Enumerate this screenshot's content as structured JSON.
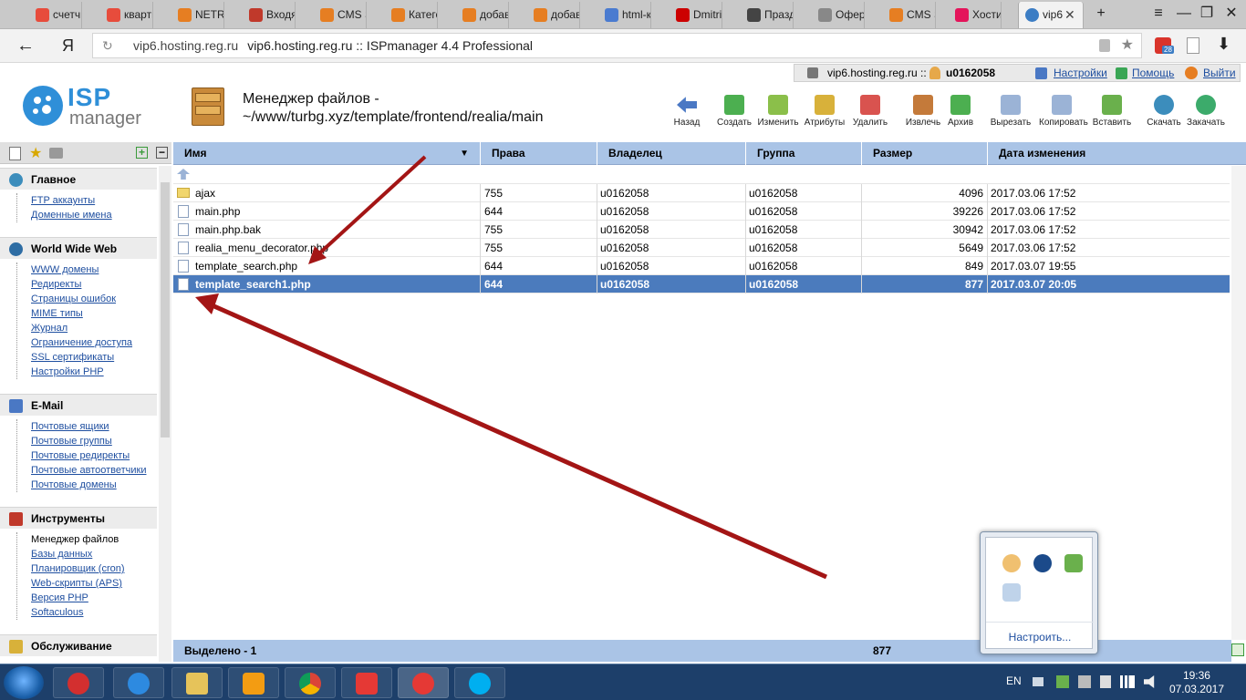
{
  "browser": {
    "tabs": [
      {
        "label": "счетчи",
        "color": "#e74c3c"
      },
      {
        "label": "кварти",
        "color": "#e74c3c"
      },
      {
        "label": "NETRO",
        "color": "#e67e22"
      },
      {
        "label": "Входящ",
        "color": "#c0392b"
      },
      {
        "label": "CMS Si",
        "color": "#e67e22"
      },
      {
        "label": "Катего",
        "color": "#e67e22"
      },
      {
        "label": "добави",
        "color": "#e67e22"
      },
      {
        "label": "добави",
        "color": "#e67e22"
      },
      {
        "label": "html-ко",
        "color": "#4a7bd0"
      },
      {
        "label": "Dmitriy",
        "color": "#cc0000"
      },
      {
        "label": "Праздн",
        "color": "#444444"
      },
      {
        "label": "Оферт",
        "color": "#888888"
      },
      {
        "label": "CMS Si",
        "color": "#e67e22"
      },
      {
        "label": "Хостин",
        "color": "#e4145a"
      }
    ],
    "active_tab": "vip6",
    "new_tab": "+",
    "menu": "≡",
    "minimize": "—",
    "restore": "❐",
    "close": "✕",
    "back": "←",
    "yandex": "Я",
    "reload": "↻",
    "domain": "vip6.hosting.reg.ru",
    "page_title": "vip6.hosting.reg.ru :: ISPmanager 4.4 Professional",
    "badge": "28"
  },
  "top": {
    "server": "vip6.hosting.reg.ru ::",
    "user": "u0162058",
    "settings": "Настройки",
    "help": "Помощь",
    "logout": "Выйти"
  },
  "logo": {
    "isp": "ISP",
    "manager": "manager"
  },
  "page": {
    "title_line1": "Менеджер файлов -",
    "title_line2": "~/www/turbg.xyz/template/frontend/realia/main"
  },
  "toolbar": [
    {
      "label": "Назад",
      "color": "#4a78c4"
    },
    {
      "label": "Создать",
      "color": "#4caf50"
    },
    {
      "label": "Изменить",
      "color": "#8bbf4a"
    },
    {
      "label": "Атрибуты",
      "color": "#d8b13a"
    },
    {
      "label": "Удалить",
      "color": "#d9534f"
    },
    {
      "label": "Извлечь",
      "color": "#c47a3a"
    },
    {
      "label": "Архив",
      "color": "#4caf50"
    },
    {
      "label": "Вырезать",
      "color": "#9bb3d6"
    },
    {
      "label": "Копировать",
      "color": "#9bb3d6"
    },
    {
      "label": "Вставить",
      "color": "#6ab04c"
    },
    {
      "label": "Скачать",
      "color": "#3c8dbc"
    },
    {
      "label": "Закачать",
      "color": "#3cab6b"
    }
  ],
  "sidebar": {
    "plus": "+",
    "minus": "−",
    "sections": [
      {
        "title": "Главное",
        "color": "#3c8dbc",
        "items": [
          "FTP аккаунты",
          "Доменные имена"
        ]
      },
      {
        "title": "World Wide Web",
        "color": "#2e6da4",
        "items": [
          "WWW домены",
          "Редиректы",
          "Страницы ошибок",
          "MIME типы",
          "Журнал",
          "Ограничение доступа",
          "SSL сертификаты",
          "Настройки PHP"
        ]
      },
      {
        "title": "E-Mail",
        "color": "#4a78c4",
        "items": [
          "Почтовые ящики",
          "Почтовые группы",
          "Почтовые редиректы",
          "Почтовые автоответчики",
          "Почтовые домены"
        ]
      },
      {
        "title": "Инструменты",
        "color": "#c0392b",
        "items": [
          "Менеджер файлов",
          "Базы данных",
          "Планировщик (cron)",
          "Web-скрипты (APS)",
          "Версия PHP",
          "Softaculous"
        ]
      },
      {
        "title": "Обслуживание",
        "color": "#d8b13a",
        "items": []
      }
    ]
  },
  "grid": {
    "headers": [
      "Имя",
      "Права",
      "Владелец",
      "Группа",
      "Размер",
      "Дата изменения"
    ],
    "sort_arrow": "▼",
    "rows": [
      {
        "name": "ajax",
        "perm": "755",
        "owner": "u0162058",
        "group": "u0162058",
        "size": "4096",
        "date": "2017.03.06 17:52"
      },
      {
        "name": "main.php",
        "perm": "644",
        "owner": "u0162058",
        "group": "u0162058",
        "size": "39226",
        "date": "2017.03.06 17:52"
      },
      {
        "name": "main.php.bak",
        "perm": "755",
        "owner": "u0162058",
        "group": "u0162058",
        "size": "30942",
        "date": "2017.03.06 17:52"
      },
      {
        "name": "realia_menu_decorator.php",
        "perm": "755",
        "owner": "u0162058",
        "group": "u0162058",
        "size": "5649",
        "date": "2017.03.06 17:52"
      },
      {
        "name": "template_search.php",
        "perm": "644",
        "owner": "u0162058",
        "group": "u0162058",
        "size": "849",
        "date": "2017.03.07 19:55"
      },
      {
        "name": "template_search1.php",
        "perm": "644",
        "owner": "u0162058",
        "group": "u0162058",
        "size": "877",
        "date": "2017.03.07 20:05"
      }
    ],
    "footer_label": "Выделено - 1",
    "footer_size": "877"
  },
  "tray": {
    "customize": "Настроить..."
  },
  "taskbar": {
    "lang": "EN",
    "time": "19:36",
    "date": "07.03.2017"
  },
  "colors": {
    "header_blue": "#aac4e6",
    "selected_row": "#4b7bbd",
    "arrow_red": "#a31515"
  }
}
